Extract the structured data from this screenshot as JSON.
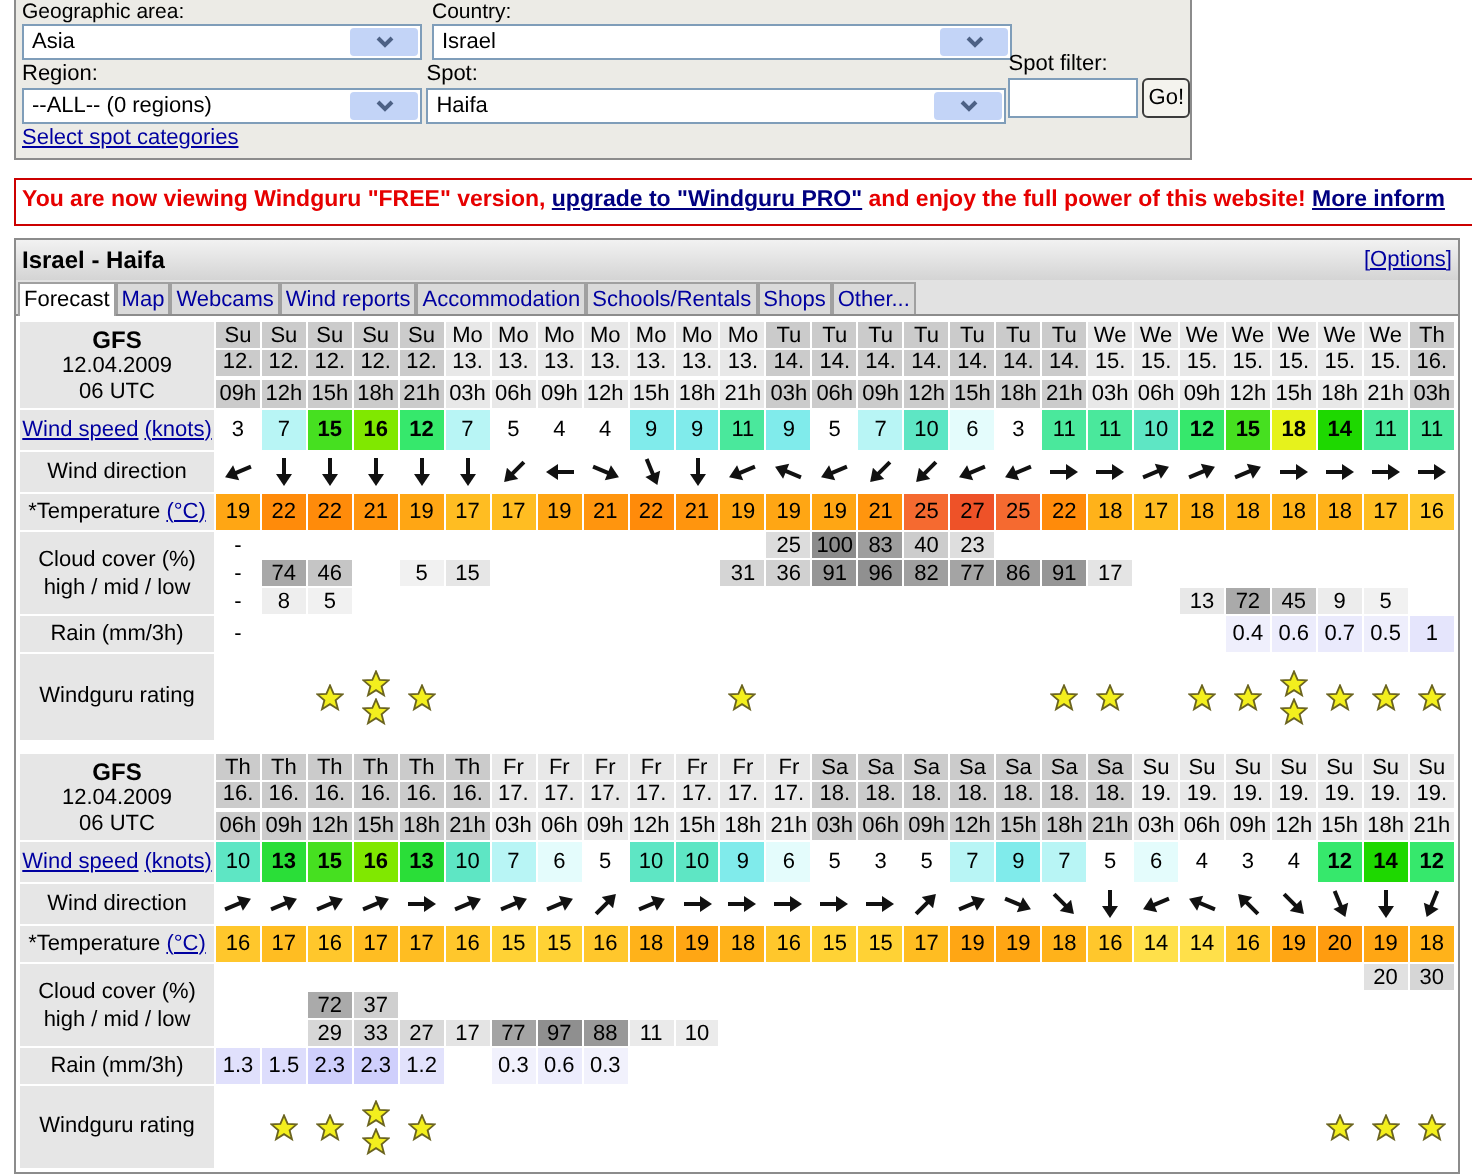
{
  "filters": {
    "geographic_area": {
      "label": "Geographic area:",
      "value": "Asia"
    },
    "country": {
      "label": "Country:",
      "value": "Israel"
    },
    "region": {
      "label": "Region:",
      "value": "--ALL-- (0 regions)"
    },
    "spot": {
      "label": "Spot:",
      "value": "Haifa"
    },
    "spot_filter": {
      "label": "Spot filter:",
      "button": "Go!"
    },
    "categories_link": "Select spot categories"
  },
  "banner": {
    "text_1": "You are now viewing Windguru \"FREE\" version, ",
    "upgrade_link": "upgrade to \"Windguru PRO\"",
    "text_2": " and enjoy the full power of this website! ",
    "more_link": "More inform"
  },
  "forecast": {
    "title": "Israel - Haifa",
    "options_link": "[Options]",
    "tabs": [
      {
        "label": "Forecast",
        "selected": true
      },
      {
        "label": "Map",
        "selected": false
      },
      {
        "label": "Webcams",
        "selected": false
      },
      {
        "label": "Wind reports",
        "selected": false
      },
      {
        "label": "Accommodation",
        "selected": false
      },
      {
        "label": "Schools/Rentals",
        "selected": false
      },
      {
        "label": "Shops",
        "selected": false
      },
      {
        "label": "Other...",
        "selected": false
      }
    ],
    "blocks": [
      {
        "model": "GFS",
        "date": "12.04.2009",
        "time": "06 UTC",
        "labels": {
          "wind_speed": "Wind speed",
          "wind_unit": "(knots)",
          "wind_direction": "Wind direction",
          "temperature": "*Temperature",
          "temperature_unit": "(°C)",
          "cloud_cover": "Cloud cover (%)",
          "cloud_levels": "high / mid / low",
          "rain": "Rain (mm/3h)",
          "rating": "Windguru rating"
        },
        "columns": [
          {
            "day": "Su",
            "date": "12.",
            "hour": "09h",
            "wind": "3",
            "kind": "wsw",
            "temp": "19",
            "high": "-",
            "mid": "-",
            "low": "-",
            "rain": "-"
          },
          {
            "day": "Su",
            "date": "12.",
            "hour": "12h",
            "wind": "7",
            "kind": "s",
            "temp": "22",
            "mid": "74",
            "low": "8"
          },
          {
            "day": "Su",
            "date": "12.",
            "hour": "15h",
            "wind": "15",
            "kind": "s",
            "temp": "22",
            "mid": "46",
            "low": "5",
            "rating": [
              {
                "kind": "star"
              }
            ]
          },
          {
            "day": "Su",
            "date": "12.",
            "hour": "18h",
            "wind": "16",
            "kind": "s",
            "temp": "21",
            "rating": [
              {
                "kind": "star"
              },
              {
                "kind": "star"
              }
            ]
          },
          {
            "day": "Su",
            "date": "12.",
            "hour": "21h",
            "wind": "12",
            "kind": "s",
            "temp": "19",
            "mid": "5",
            "rating": [
              {
                "kind": "star"
              }
            ]
          },
          {
            "day": "Mo",
            "date": "13.",
            "hour": "03h",
            "wind": "7",
            "kind": "s",
            "temp": "17",
            "mid": "15"
          },
          {
            "day": "Mo",
            "date": "13.",
            "hour": "06h",
            "wind": "5",
            "kind": "sw",
            "temp": "17"
          },
          {
            "day": "Mo",
            "date": "13.",
            "hour": "09h",
            "wind": "4",
            "kind": "w",
            "temp": "19"
          },
          {
            "day": "Mo",
            "date": "13.",
            "hour": "12h",
            "wind": "4",
            "kind": "ese",
            "temp": "21"
          },
          {
            "day": "Mo",
            "date": "13.",
            "hour": "15h",
            "wind": "9",
            "kind": "sse",
            "temp": "22"
          },
          {
            "day": "Mo",
            "date": "13.",
            "hour": "18h",
            "wind": "9",
            "kind": "s",
            "temp": "21"
          },
          {
            "day": "Mo",
            "date": "13.",
            "hour": "21h",
            "wind": "11",
            "kind": "wsw",
            "temp": "19",
            "mid": "31",
            "rating": [
              {
                "kind": "star"
              }
            ]
          },
          {
            "day": "Tu",
            "date": "14.",
            "hour": "03h",
            "wind": "9",
            "kind": "wnw",
            "temp": "19",
            "high": "25",
            "mid": "36"
          },
          {
            "day": "Tu",
            "date": "14.",
            "hour": "06h",
            "wind": "5",
            "kind": "wsw",
            "temp": "19",
            "high": "100",
            "mid": "91"
          },
          {
            "day": "Tu",
            "date": "14.",
            "hour": "09h",
            "wind": "7",
            "kind": "sw",
            "temp": "21",
            "high": "83",
            "mid": "96"
          },
          {
            "day": "Tu",
            "date": "14.",
            "hour": "12h",
            "wind": "10",
            "kind": "sw",
            "temp": "25",
            "high": "40",
            "mid": "82"
          },
          {
            "day": "Tu",
            "date": "14.",
            "hour": "15h",
            "wind": "6",
            "kind": "wsw",
            "temp": "27",
            "high": "23",
            "mid": "77"
          },
          {
            "day": "Tu",
            "date": "14.",
            "hour": "18h",
            "wind": "3",
            "kind": "wsw",
            "temp": "25",
            "mid": "86"
          },
          {
            "day": "Tu",
            "date": "14.",
            "hour": "21h",
            "wind": "11",
            "kind": "e",
            "temp": "22",
            "mid": "91",
            "rating": [
              {
                "kind": "star"
              }
            ]
          },
          {
            "day": "We",
            "date": "15.",
            "hour": "03h",
            "wind": "11",
            "kind": "e",
            "temp": "18",
            "mid": "17",
            "rating": [
              {
                "kind": "star"
              }
            ]
          },
          {
            "day": "We",
            "date": "15.",
            "hour": "06h",
            "wind": "10",
            "kind": "ene",
            "temp": "17"
          },
          {
            "day": "We",
            "date": "15.",
            "hour": "09h",
            "wind": "12",
            "kind": "ene",
            "temp": "18",
            "low": "13",
            "rating": [
              {
                "kind": "star"
              }
            ]
          },
          {
            "day": "We",
            "date": "15.",
            "hour": "12h",
            "wind": "15",
            "kind": "ene",
            "temp": "18",
            "low": "72",
            "rain": "0.4",
            "rating": [
              {
                "kind": "star"
              }
            ]
          },
          {
            "day": "We",
            "date": "15.",
            "hour": "15h",
            "wind": "18",
            "kind": "e",
            "temp": "18",
            "low": "45",
            "rain": "0.6",
            "rating": [
              {
                "kind": "star"
              },
              {
                "kind": "star"
              }
            ]
          },
          {
            "day": "We",
            "date": "15.",
            "hour": "18h",
            "wind": "14",
            "kind": "e",
            "temp": "18",
            "low": "9",
            "rain": "0.7",
            "rating": [
              {
                "kind": "star"
              }
            ]
          },
          {
            "day": "We",
            "date": "15.",
            "hour": "21h",
            "wind": "11",
            "kind": "e",
            "temp": "17",
            "low": "5",
            "rain": "0.5",
            "rating": [
              {
                "kind": "star"
              }
            ]
          },
          {
            "day": "Th",
            "date": "16.",
            "hour": "03h",
            "wind": "11",
            "kind": "e",
            "temp": "16",
            "rain": "1",
            "rating": [
              {
                "kind": "star"
              }
            ]
          }
        ]
      },
      {
        "model": "GFS",
        "date": "12.04.2009",
        "time": "06 UTC",
        "labels": {
          "wind_speed": "Wind speed",
          "wind_unit": "(knots)",
          "wind_direction": "Wind direction",
          "temperature": "*Temperature",
          "temperature_unit": "(°C)",
          "cloud_cover": "Cloud cover (%)",
          "cloud_levels": "high / mid / low",
          "rain": "Rain (mm/3h)",
          "rating": "Windguru rating"
        },
        "columns": [
          {
            "day": "Th",
            "date": "16.",
            "hour": "06h",
            "wind": "10",
            "kind": "ene",
            "temp": "16",
            "rain": "1.3"
          },
          {
            "day": "Th",
            "date": "16.",
            "hour": "09h",
            "wind": "13",
            "kind": "ene",
            "temp": "17",
            "rain": "1.5",
            "rating": [
              {
                "kind": "star"
              }
            ]
          },
          {
            "day": "Th",
            "date": "16.",
            "hour": "12h",
            "wind": "15",
            "kind": "ene",
            "temp": "16",
            "mid": "72",
            "low": "29",
            "rain": "2.3",
            "rating": [
              {
                "kind": "star"
              }
            ]
          },
          {
            "day": "Th",
            "date": "16.",
            "hour": "15h",
            "wind": "16",
            "kind": "ene",
            "temp": "17",
            "mid": "37",
            "low": "33",
            "rain": "2.3",
            "rating": [
              {
                "kind": "star"
              },
              {
                "kind": "star"
              }
            ]
          },
          {
            "day": "Th",
            "date": "16.",
            "hour": "18h",
            "wind": "13",
            "kind": "e",
            "temp": "17",
            "low": "27",
            "rain": "1.2",
            "rating": [
              {
                "kind": "star"
              }
            ]
          },
          {
            "day": "Th",
            "date": "16.",
            "hour": "21h",
            "wind": "10",
            "kind": "ene",
            "temp": "16",
            "low": "17"
          },
          {
            "day": "Fr",
            "date": "17.",
            "hour": "03h",
            "wind": "7",
            "kind": "ene",
            "temp": "15",
            "low": "77",
            "rain": "0.3"
          },
          {
            "day": "Fr",
            "date": "17.",
            "hour": "06h",
            "wind": "6",
            "kind": "ene",
            "temp": "15",
            "low": "97",
            "rain": "0.6"
          },
          {
            "day": "Fr",
            "date": "17.",
            "hour": "09h",
            "wind": "5",
            "kind": "ne",
            "temp": "16",
            "low": "88",
            "rain": "0.3"
          },
          {
            "day": "Fr",
            "date": "17.",
            "hour": "12h",
            "wind": "10",
            "kind": "ene",
            "temp": "18",
            "low": "11"
          },
          {
            "day": "Fr",
            "date": "17.",
            "hour": "15h",
            "wind": "10",
            "kind": "e",
            "temp": "19",
            "low": "10"
          },
          {
            "day": "Fr",
            "date": "17.",
            "hour": "18h",
            "wind": "9",
            "kind": "e",
            "temp": "18"
          },
          {
            "day": "Fr",
            "date": "17.",
            "hour": "21h",
            "wind": "6",
            "kind": "e",
            "temp": "16"
          },
          {
            "day": "Sa",
            "date": "18.",
            "hour": "03h",
            "wind": "5",
            "kind": "e",
            "temp": "15"
          },
          {
            "day": "Sa",
            "date": "18.",
            "hour": "06h",
            "wind": "3",
            "kind": "e",
            "temp": "15"
          },
          {
            "day": "Sa",
            "date": "18.",
            "hour": "09h",
            "wind": "5",
            "kind": "ne",
            "temp": "17"
          },
          {
            "day": "Sa",
            "date": "18.",
            "hour": "12h",
            "wind": "7",
            "kind": "ene",
            "temp": "19"
          },
          {
            "day": "Sa",
            "date": "18.",
            "hour": "15h",
            "wind": "9",
            "kind": "ese",
            "temp": "19"
          },
          {
            "day": "Sa",
            "date": "18.",
            "hour": "18h",
            "wind": "7",
            "kind": "se",
            "temp": "18"
          },
          {
            "day": "Sa",
            "date": "18.",
            "hour": "21h",
            "wind": "5",
            "kind": "s",
            "temp": "16"
          },
          {
            "day": "Su",
            "date": "19.",
            "hour": "03h",
            "wind": "6",
            "kind": "wsw",
            "temp": "14"
          },
          {
            "day": "Su",
            "date": "19.",
            "hour": "06h",
            "wind": "4",
            "kind": "wnw",
            "temp": "14"
          },
          {
            "day": "Su",
            "date": "19.",
            "hour": "09h",
            "wind": "3",
            "kind": "nw",
            "temp": "16"
          },
          {
            "day": "Su",
            "date": "19.",
            "hour": "12h",
            "wind": "4",
            "kind": "se",
            "temp": "19"
          },
          {
            "day": "Su",
            "date": "19.",
            "hour": "15h",
            "wind": "12",
            "kind": "sse",
            "temp": "20",
            "rating": [
              {
                "kind": "star"
              }
            ]
          },
          {
            "day": "Su",
            "date": "19.",
            "hour": "18h",
            "wind": "14",
            "kind": "s",
            "temp": "19",
            "high": "20",
            "rating": [
              {
                "kind": "star"
              }
            ]
          },
          {
            "day": "Su",
            "date": "19.",
            "hour": "21h",
            "wind": "12",
            "kind": "ssw",
            "temp": "18",
            "high": "30",
            "rating": [
              {
                "kind": "star"
              }
            ]
          }
        ]
      }
    ]
  }
}
